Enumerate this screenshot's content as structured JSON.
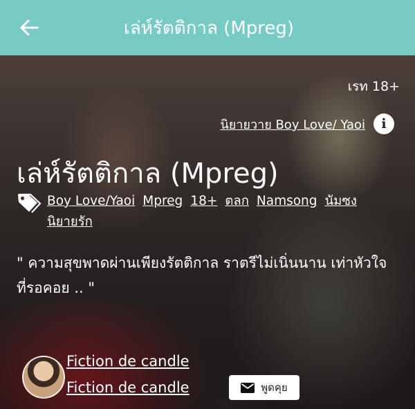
{
  "app_bar": {
    "title": "เล่ห์รัตติกาล (Mpreg)"
  },
  "hero": {
    "rating": "เรท 18+",
    "category": "นิยายวาย Boy Love/ Yaoi",
    "story_title": "เล่ห์รัตติกาล (Mpreg)",
    "tags": [
      "Boy Love/Yaoi",
      "Mpreg",
      "18+",
      "ตลก",
      "Namsong",
      "นัมซง",
      "นิยายรัก"
    ],
    "quote": "\" ความสุขพาดผ่านเพียงรัตติกาล ราตรีไม่เนิ่นนาน เท่าหัวใจที่รอคอย .. \""
  },
  "author": {
    "pen_name": "Fiction de candle",
    "display_name": "Fiction de candle",
    "chat_label": "พูดคุย"
  },
  "colors": {
    "app_bar": "#78cbc4",
    "text": "#ffffff"
  }
}
